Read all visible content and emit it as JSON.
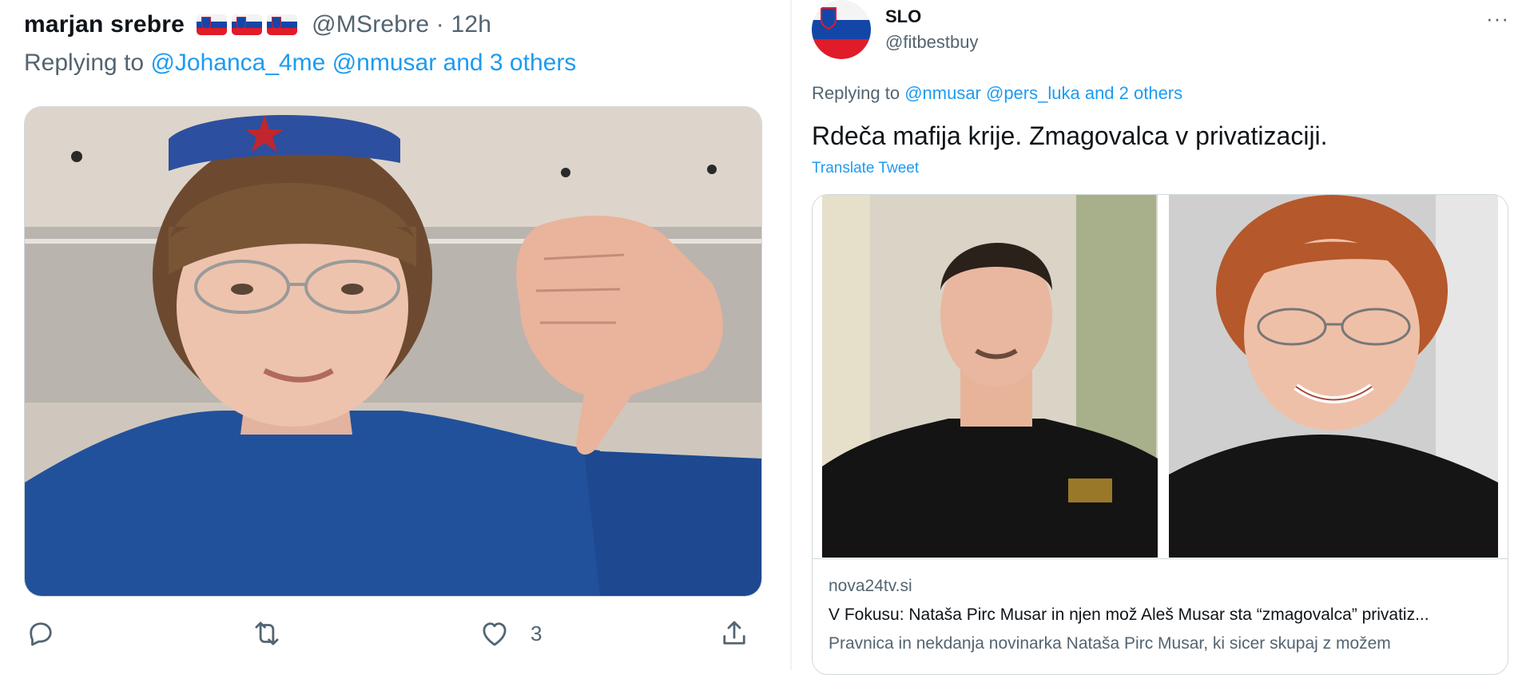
{
  "left_tweet": {
    "author_name": "marjan srebre",
    "author_handle": "@MSrebre · 12h",
    "replying_prefix": "Replying to ",
    "reply_mentions": "@Johanca_4me @nmusar and 3 others",
    "image_alt": "Photo",
    "actions": {
      "reply_icon": "reply-icon",
      "retweet_icon": "retweet-icon",
      "like_icon": "heart-icon",
      "like_count": "3",
      "share_icon": "share-icon"
    }
  },
  "right_tweet": {
    "author_name": "SLO",
    "author_handle": "@fitbestbuy",
    "more_icon": "···",
    "replying_prefix": "Replying to ",
    "reply_mentions": "@nmusar @pers_luka and 2 others",
    "text": "Rdeča mafija krije. Zmagovalca v privatizaciji.",
    "translate_label": "Translate Tweet",
    "card": {
      "domain": "nova24tv.si",
      "title": "V Fokusu: Nataša Pirc Musar in njen mož Aleš Musar sta “zmagovalca” privatiz...",
      "description": "Pravnica in nekdanja novinarka Nataša Pirc Musar, ki sicer skupaj z možem"
    }
  },
  "colors": {
    "accent": "#1d9bf0",
    "muted": "#536471",
    "text": "#0f1419",
    "border": "#cfd9de"
  }
}
